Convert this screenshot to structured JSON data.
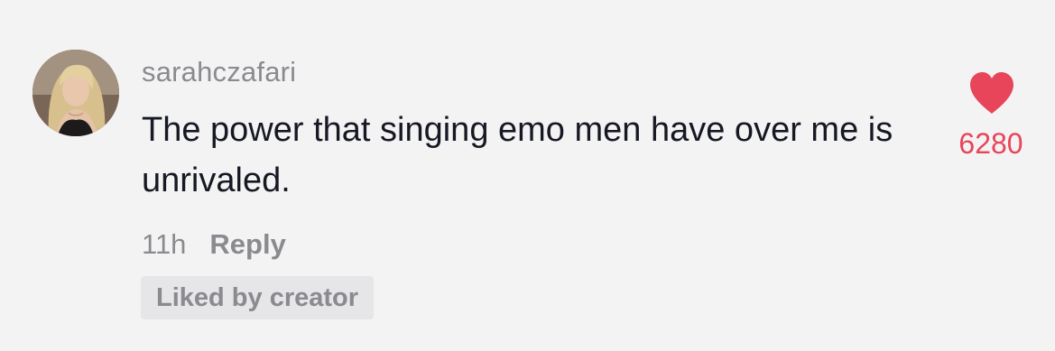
{
  "comment": {
    "username": "sarahczafari",
    "text": "The power that singing emo men have over me is unrivaled.",
    "time": "11h",
    "reply_label": "Reply",
    "liked_by_creator_label": "Liked by creator",
    "like_count": "6280",
    "liked": true,
    "avatar_icon": "profile-photo"
  },
  "colors": {
    "background": "#f4f3f4",
    "text": "#161823",
    "muted": "#8a8a8f",
    "like": "#e8445a",
    "badge_bg": "#e6e5e7"
  },
  "icons": {
    "like": "heart-icon"
  }
}
